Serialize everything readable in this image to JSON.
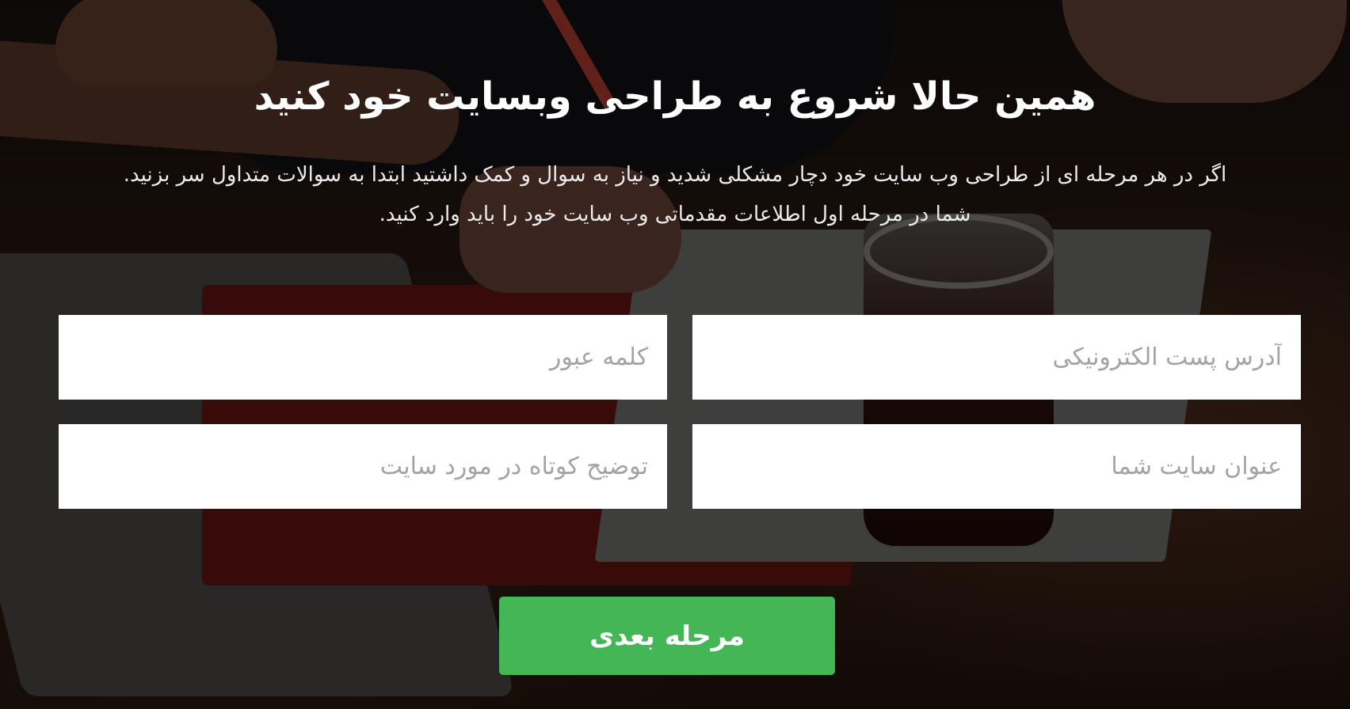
{
  "hero": {
    "title": "همین حالا شروع به طراحی وبسایت خود کنید",
    "description_line1": "اگر در هر مرحله ای از طراحی وب سایت خود دچار مشکلی شدید و نیاز به سوال و کمک داشتید ابتدا به سوالات متداول سر بزنید.",
    "description_line2": "شما در مرحله اول اطلاعات مقدماتی وب سایت خود را باید وارد کنید."
  },
  "form": {
    "email": {
      "placeholder": "آدرس پست الکترونیکی",
      "value": ""
    },
    "password": {
      "placeholder": "کلمه عبور",
      "value": ""
    },
    "site_title": {
      "placeholder": "عنوان سایت شما",
      "value": ""
    },
    "site_description": {
      "placeholder": "توضیح کوتاه در مورد سایت",
      "value": ""
    },
    "submit_label": "مرحله بعدی"
  },
  "colors": {
    "button_bg": "#45b656",
    "text_light": "#ffffff",
    "overlay": "#000000"
  }
}
